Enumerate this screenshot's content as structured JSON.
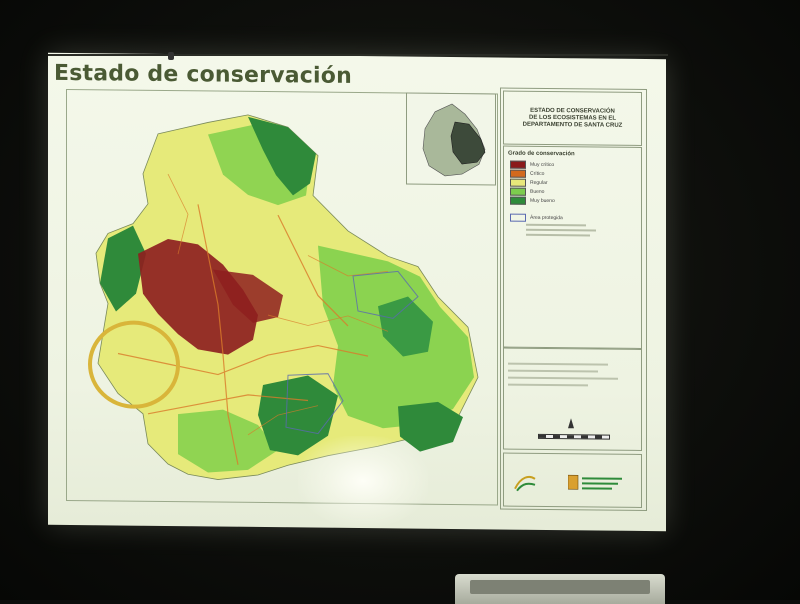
{
  "slide": {
    "title": "Estado de conservación",
    "map_title_lines": [
      "ESTADO DE CONSERVACIÓN",
      "DE LOS ECOSISTEMAS EN EL",
      "DEPARTAMENTO DE SANTA CRUZ"
    ]
  },
  "legend": {
    "heading": "Grado de conservación",
    "items": [
      {
        "label": "Muy crítico",
        "color": "#8b1a1a"
      },
      {
        "label": "Crítico",
        "color": "#d2691e"
      },
      {
        "label": "Regular",
        "color": "#e8e87a"
      },
      {
        "label": "Bueno",
        "color": "#7ccc4e"
      },
      {
        "label": "Muy bueno",
        "color": "#2e8b3a"
      }
    ],
    "protected_heading": "Área protegida"
  },
  "colors": {
    "highlight": "#d9b53a",
    "muy_critico": "#8b1a1a",
    "regular": "#e8e87a",
    "bueno": "#7ccc4e",
    "muy_bueno": "#2e8b3a"
  }
}
